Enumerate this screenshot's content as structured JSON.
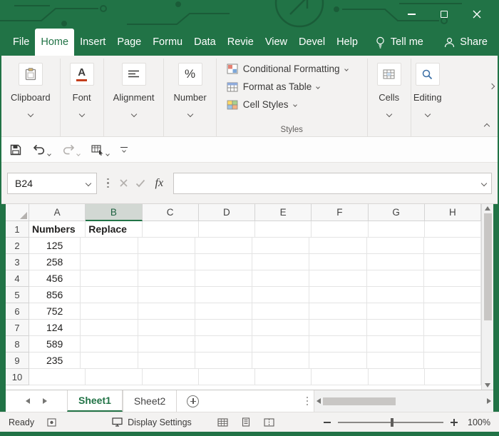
{
  "menubar": {
    "tabs": [
      {
        "id": "file",
        "label": "File",
        "active": false
      },
      {
        "id": "home",
        "label": "Home",
        "active": true
      },
      {
        "id": "insert",
        "label": "Insert",
        "active": false
      },
      {
        "id": "page-layout",
        "label": "Page",
        "active": false
      },
      {
        "id": "formulas",
        "label": "Formu",
        "active": false
      },
      {
        "id": "data",
        "label": "Data",
        "active": false
      },
      {
        "id": "review",
        "label": "Revie",
        "active": false
      },
      {
        "id": "view",
        "label": "View",
        "active": false
      },
      {
        "id": "developer",
        "label": "Devel",
        "active": false
      },
      {
        "id": "help",
        "label": "Help",
        "active": false
      }
    ],
    "tell_me_label": "Tell me",
    "share_label": "Share"
  },
  "ribbon": {
    "groups": [
      {
        "id": "clipboard",
        "label": "Clipboard"
      },
      {
        "id": "font",
        "label": "Font"
      },
      {
        "id": "alignment",
        "label": "Alignment"
      },
      {
        "id": "number",
        "label": "Number"
      },
      {
        "id": "cells",
        "label": "Cells"
      },
      {
        "id": "editing",
        "label": "Editing"
      }
    ],
    "icons": {
      "font_glyph": "A",
      "number_glyph": "%"
    },
    "styles_group": {
      "items": [
        {
          "label": "Conditional Formatting"
        },
        {
          "label": "Format as Table"
        },
        {
          "label": "Cell Styles"
        }
      ],
      "caption": "Styles"
    }
  },
  "formula_bar": {
    "name_box": "B24",
    "fx_label": "fx",
    "formula_value": ""
  },
  "grid": {
    "columns": [
      "A",
      "B",
      "C",
      "D",
      "E",
      "F",
      "G",
      "H"
    ],
    "selected_column": "B",
    "row_count": 10,
    "cells": [
      {
        "col": "A",
        "row": 1,
        "value": "Numbers",
        "bold": true
      },
      {
        "col": "B",
        "row": 1,
        "value": "Replace",
        "bold": true
      },
      {
        "col": "A",
        "row": 2,
        "value": "125"
      },
      {
        "col": "A",
        "row": 3,
        "value": "258"
      },
      {
        "col": "A",
        "row": 4,
        "value": "456"
      },
      {
        "col": "A",
        "row": 5,
        "value": "856"
      },
      {
        "col": "A",
        "row": 6,
        "value": "752"
      },
      {
        "col": "A",
        "row": 7,
        "value": "124"
      },
      {
        "col": "A",
        "row": 8,
        "value": "589"
      },
      {
        "col": "A",
        "row": 9,
        "value": "235"
      }
    ]
  },
  "sheet_bar": {
    "tabs": [
      {
        "label": "Sheet1",
        "active": true
      },
      {
        "label": "Sheet2",
        "active": false
      }
    ]
  },
  "status_bar": {
    "mode": "Ready",
    "display_settings_label": "Display Settings",
    "zoom_level": "100%"
  },
  "colors": {
    "excel_green": "#217346",
    "selected_header_bg": "#d2d8d3",
    "ribbon_bg": "#f3f2f1"
  }
}
